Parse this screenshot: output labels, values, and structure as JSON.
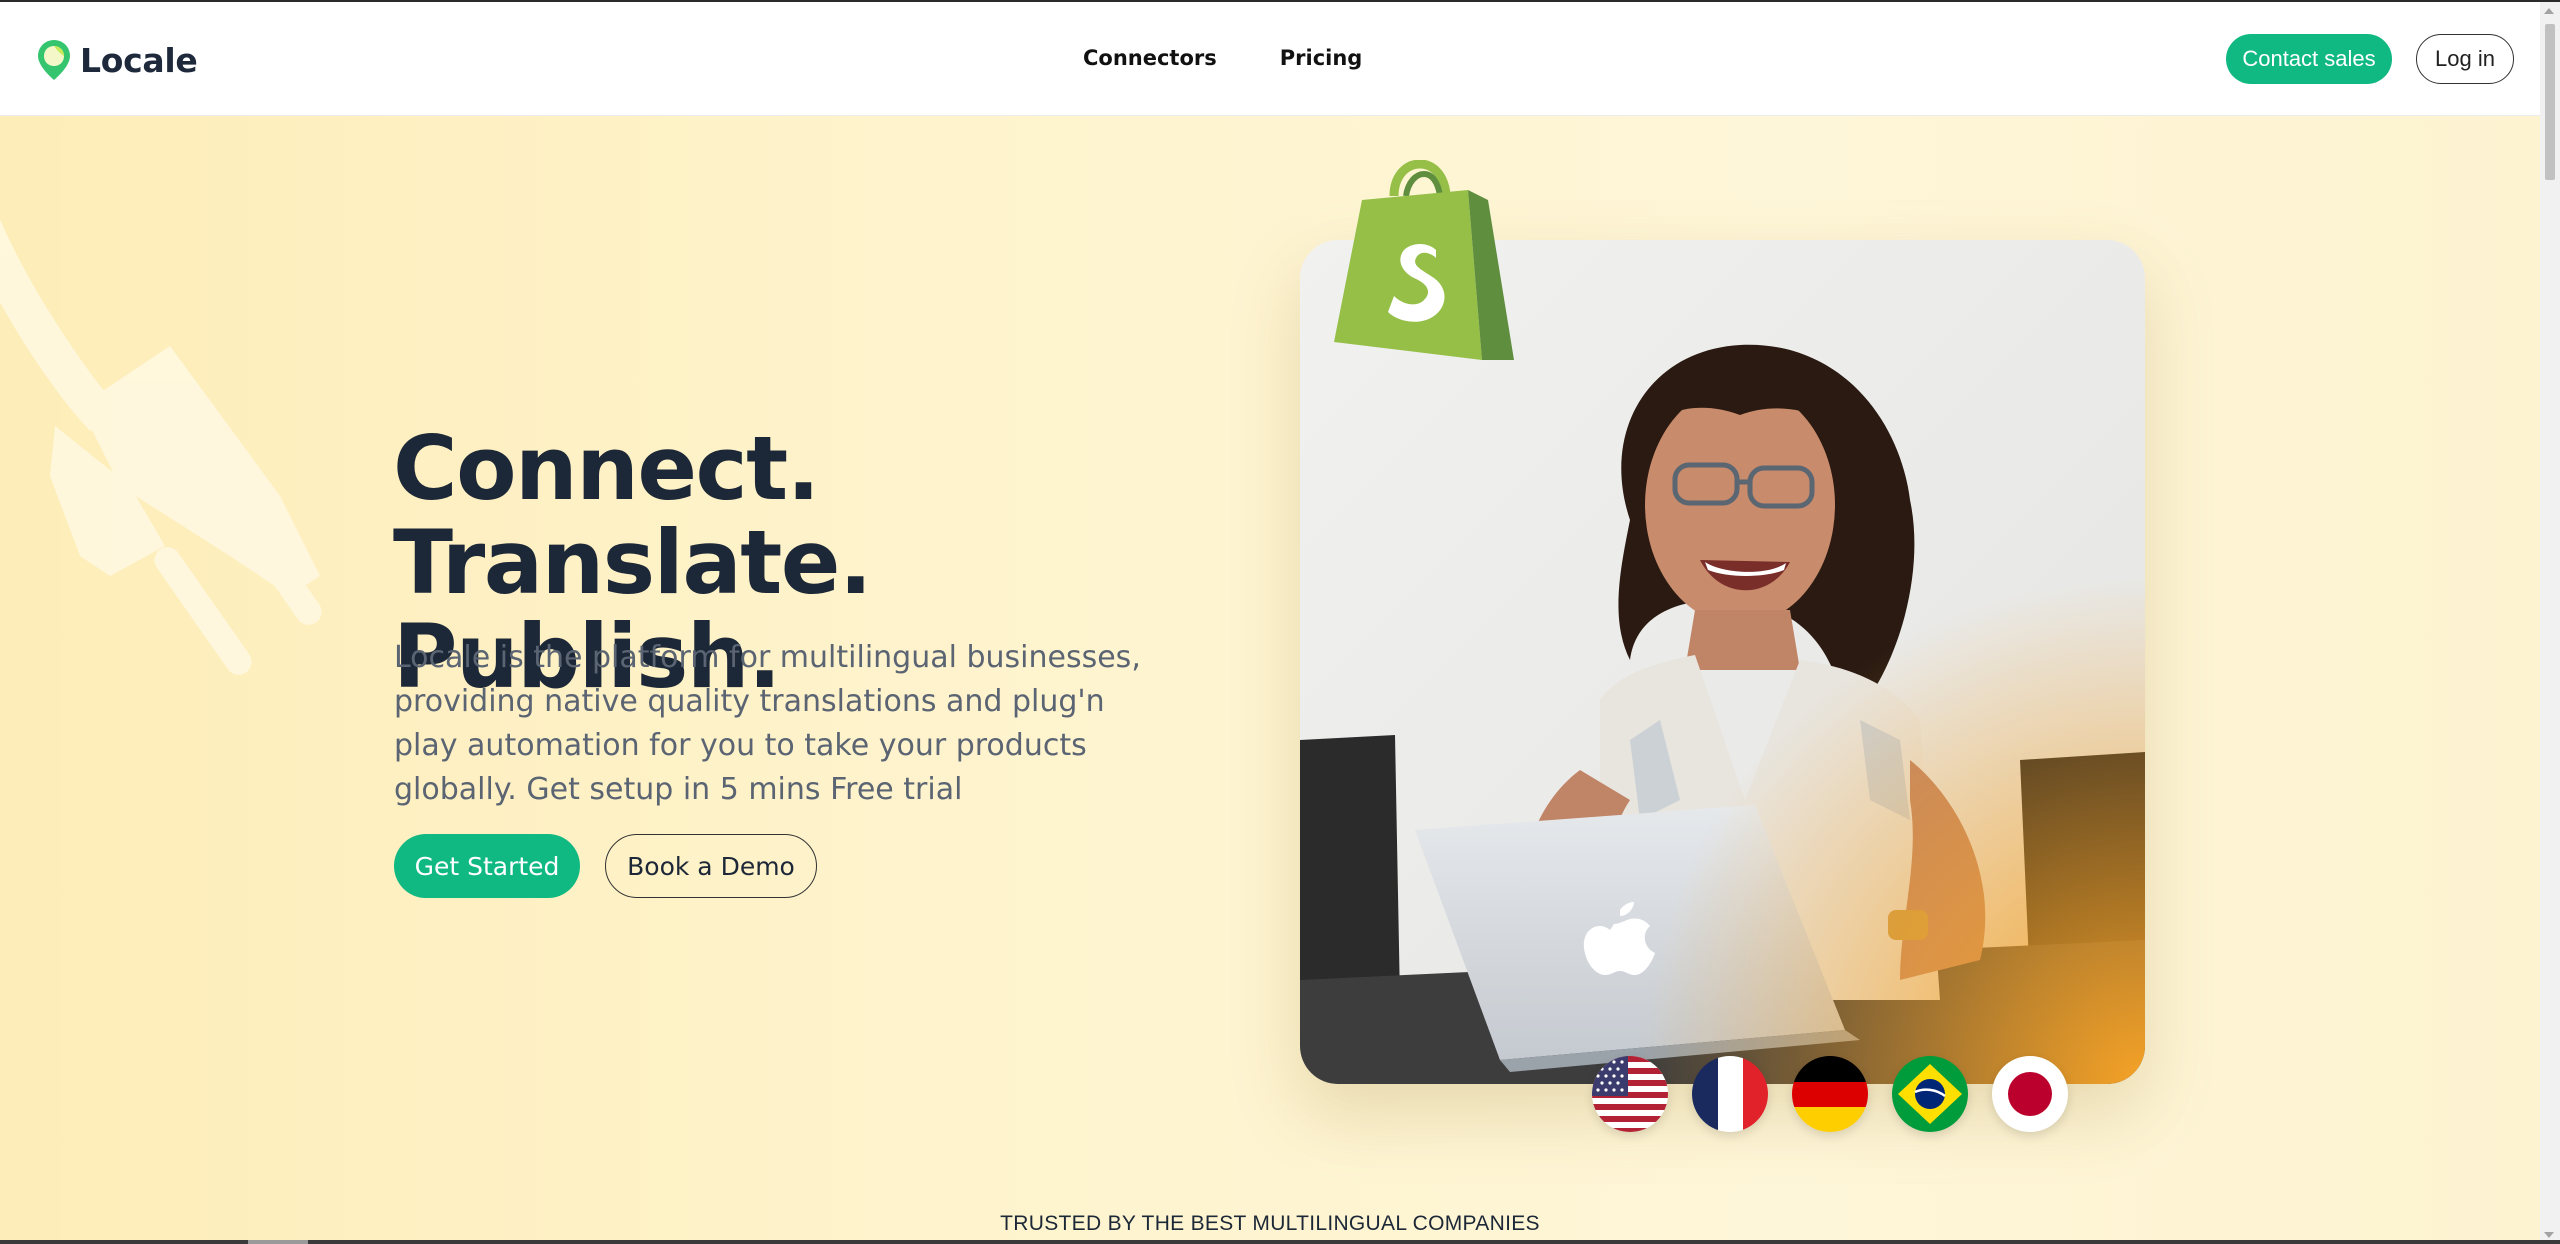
{
  "header": {
    "brand": "Locale",
    "nav": [
      {
        "label": "Connectors"
      },
      {
        "label": "Pricing"
      }
    ],
    "contact_label": "Contact sales",
    "login_label": "Log in"
  },
  "hero": {
    "title_line1": "Connect. Translate.",
    "title_line2": "Publish.",
    "subtitle": "Locale is the platform for multilingual businesses, providing native quality translations and plug'n play automation for you to take your products globally. Get setup in 5 mins Free trial",
    "primary_cta": "Get Started",
    "secondary_cta": "Book a Demo",
    "flags": [
      "us-flag",
      "france-flag",
      "germany-flag",
      "brazil-flag",
      "japan-flag"
    ]
  },
  "trusted": {
    "label": "TRUSTED BY THE BEST MULTILINGUAL COMPANIES"
  },
  "colors": {
    "accent": "#10b981",
    "heading": "#1c2837",
    "hero_bg": "#fef3cc",
    "shopify_green": "#95bf47"
  }
}
